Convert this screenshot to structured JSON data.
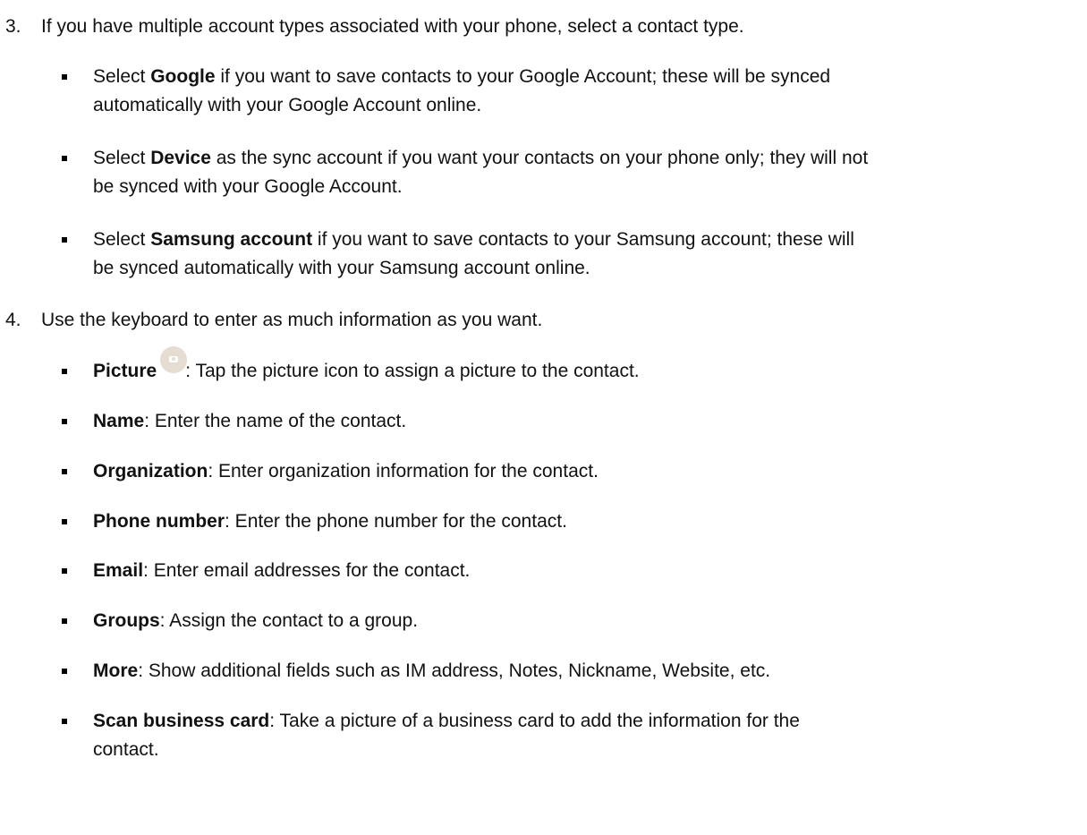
{
  "step3": {
    "number": "3.",
    "text": "If you have multiple account types associated with your phone, select a contact type.",
    "bullets": [
      {
        "bold": "Google",
        "pre": "Select ",
        "rest_line1": " if you want to save contacts to your Google Account; these will be synced",
        "line2": "automatically with your Google Account online."
      },
      {
        "bold": "Device",
        "pre": "Select ",
        "rest_line1": " as the sync account if you want your contacts on your phone only; they will not",
        "line2": "be synced with your Google Account."
      },
      {
        "bold": "Samsung account",
        "pre": "Select ",
        "rest_line1": " if you want to save contacts to your Samsung account; these will",
        "line2": "be synced automatically with your Samsung account online."
      }
    ]
  },
  "step4": {
    "number": "4.",
    "text": "Use the keyboard to enter as much information as you want.",
    "bullets": [
      {
        "bold": "Picture",
        "rest": ": Tap the picture icon to assign a picture to the contact.",
        "icon": "camera-icon"
      },
      {
        "bold": "Name",
        "rest": ": Enter the name of the contact."
      },
      {
        "bold": "Organization",
        "rest": ": Enter organization information for the contact."
      },
      {
        "bold": "Phone number",
        "rest": ": Enter the phone number for the contact."
      },
      {
        "bold": "Email",
        "rest": ": Enter email addresses for the contact."
      },
      {
        "bold": "Groups",
        "rest": ": Assign the contact to a group."
      },
      {
        "bold": "More",
        "rest": ": Show additional fields such as IM address, Notes, Nickname, Website, etc."
      },
      {
        "bold": "Scan business card",
        "rest": ": Take a picture of a business card to add the information for the",
        "line2": "contact."
      }
    ]
  }
}
